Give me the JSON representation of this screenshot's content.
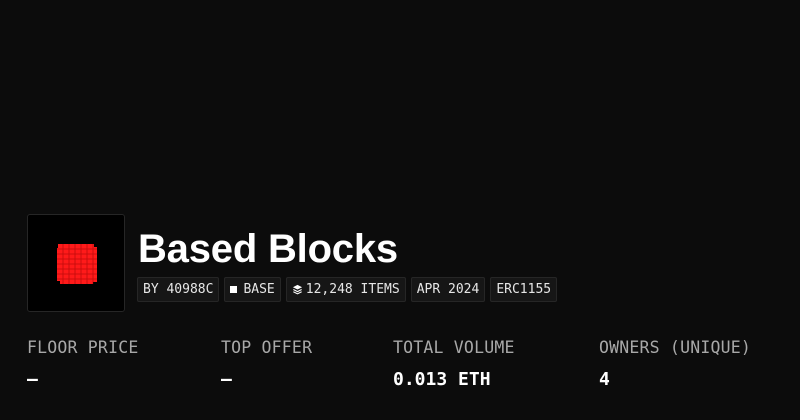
{
  "collection": {
    "name": "Based Blocks",
    "chips": {
      "creator": "BY 40988C",
      "chain": "BASE",
      "items": "12,248 ITEMS",
      "date": "APR 2024",
      "standard": "ERC1155"
    },
    "accent_color": "#ff1a1a"
  },
  "stats": {
    "floor_price": {
      "label": "FLOOR PRICE",
      "value": "—"
    },
    "top_offer": {
      "label": "TOP OFFER",
      "value": "—"
    },
    "total_volume": {
      "label": "TOTAL VOLUME",
      "value": "0.013 ETH"
    },
    "owners": {
      "label": "OWNERS (UNIQUE)",
      "value": "4"
    }
  }
}
